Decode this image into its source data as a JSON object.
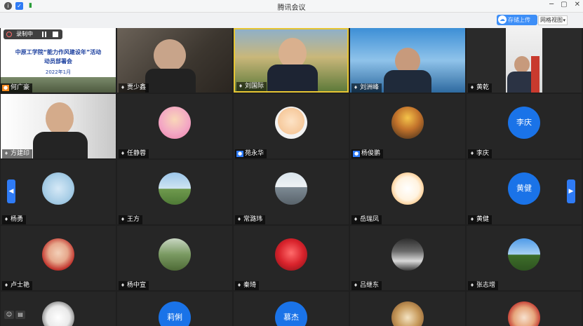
{
  "window": {
    "title": "腾讯会议",
    "controls": {
      "minimize": "─",
      "restore": "▢",
      "close": "✕"
    }
  },
  "toolbar": {
    "cloud_button": "存储上传",
    "view_button": "网格视图"
  },
  "recording": {
    "label": "录制中"
  },
  "slide": {
    "title_line1": "中原工学院“能力作风建设年”活动",
    "title_line2": "动员部署会",
    "date": "2022年1月"
  },
  "participants": [
    {
      "name": "何广豪"
    },
    {
      "name": "贾少鑫"
    },
    {
      "name": "刘国际"
    },
    {
      "name": "刘洲峰"
    },
    {
      "name": "黄乾"
    },
    {
      "name": "方建印"
    },
    {
      "name": "任静蓉"
    },
    {
      "name": "苑永华"
    },
    {
      "name": "杨俊鹏"
    },
    {
      "name": "李庆",
      "avatar_text": "李庆"
    },
    {
      "name": "杨勇"
    },
    {
      "name": "王方"
    },
    {
      "name": "常潞玮"
    },
    {
      "name": "岳瑞凤"
    },
    {
      "name": "黄健",
      "avatar_text": "黄健"
    },
    {
      "name": "卢士艳"
    },
    {
      "name": "杨中宣"
    },
    {
      "name": "秦琦"
    },
    {
      "name": "吕继东"
    },
    {
      "name": "张志增"
    },
    {
      "name": ""
    },
    {
      "name": "",
      "avatar_text": "莉俐"
    },
    {
      "name": "",
      "avatar_text": "慕杰"
    },
    {
      "name": ""
    },
    {
      "name": ""
    }
  ],
  "colors": {
    "accent": "#2f7bf5",
    "tile_bg": "#262626",
    "avatar_blue": "#1a73e8"
  }
}
